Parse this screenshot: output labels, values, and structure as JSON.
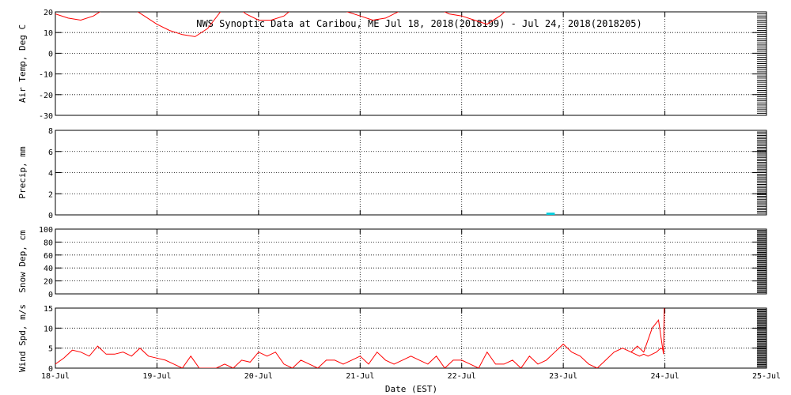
{
  "chart_data": {
    "type": "line",
    "title": "NWS Synoptic Data at Caribou, ME   Jul 18, 2018(2018199) - Jul 24, 2018(2018205)",
    "xlabel": "Date (EST)",
    "x_tick_labels": [
      "18-Jul",
      "19-Jul",
      "20-Jul",
      "21-Jul",
      "22-Jul",
      "23-Jul",
      "24-Jul",
      "25-Jul"
    ],
    "xlim": [
      "2018-07-18",
      "2018-07-25"
    ],
    "grid": true,
    "panels": [
      {
        "ylabel": "Air Temp, Deg C",
        "ylim": [
          -30,
          20
        ],
        "yticks": [
          -30,
          -20,
          -10,
          0,
          10,
          20
        ],
        "series": [
          {
            "color": "#ff0000",
            "x": [
              "2018-07-18T00:00",
              "2018-07-18T03:00",
              "2018-07-18T06:00",
              "2018-07-18T09:00",
              "2018-07-18T12:00",
              "2018-07-18T15:00",
              "2018-07-18T18:00",
              "2018-07-18T21:00",
              "2018-07-19T00:00",
              "2018-07-19T03:00",
              "2018-07-19T06:00",
              "2018-07-19T09:00",
              "2018-07-19T12:00",
              "2018-07-19T15:00",
              "2018-07-19T18:00",
              "2018-07-19T21:00",
              "2018-07-20T00:00",
              "2018-07-20T03:00",
              "2018-07-20T06:00",
              "2018-07-20T09:00",
              "2018-07-20T12:00",
              "2018-07-20T15:00",
              "2018-07-20T18:00",
              "2018-07-20T21:00",
              "2018-07-21T00:00",
              "2018-07-21T03:00",
              "2018-07-21T06:00",
              "2018-07-21T09:00",
              "2018-07-21T12:00",
              "2018-07-21T15:00",
              "2018-07-21T18:00",
              "2018-07-21T21:00",
              "2018-07-22T00:00",
              "2018-07-22T03:00",
              "2018-07-22T06:00",
              "2018-07-22T09:00",
              "2018-07-22T12:00"
            ],
            "y": [
              19,
              17,
              16,
              18,
              22,
              24,
              22,
              18,
              14,
              11,
              9,
              8,
              12,
              20,
              24,
              19,
              16,
              16,
              18,
              23,
              25,
              24,
              22,
              20,
              18,
              16,
              17,
              20,
              24,
              25,
              22,
              19,
              18,
              16,
              14,
              18,
              23
            ]
          }
        ]
      },
      {
        "ylabel": "Precip, mm",
        "ylim": [
          0,
          8
        ],
        "yticks": [
          0,
          2,
          4,
          6,
          8
        ],
        "series": [
          {
            "color": "#00ccdd",
            "x": [
              "2018-07-22T20:00",
              "2018-07-22T21:00",
              "2018-07-22T22:00"
            ],
            "y": [
              0.1,
              0.1,
              0.1
            ]
          }
        ]
      },
      {
        "ylabel": "Snow Dep, cm",
        "ylim": [
          0,
          100
        ],
        "yticks": [
          0,
          20,
          40,
          60,
          80,
          100
        ],
        "series": []
      },
      {
        "ylabel": "Wind Spd, m/s",
        "ylim": [
          0,
          15
        ],
        "yticks": [
          0,
          5,
          10,
          15
        ],
        "series": [
          {
            "color": "#ff0000",
            "x": [
              "2018-07-18T00:00",
              "2018-07-18T02:00",
              "2018-07-18T04:00",
              "2018-07-18T06:00",
              "2018-07-18T08:00",
              "2018-07-18T10:00",
              "2018-07-18T12:00",
              "2018-07-18T14:00",
              "2018-07-18T16:00",
              "2018-07-18T18:00",
              "2018-07-18T20:00",
              "2018-07-18T22:00",
              "2018-07-19T00:00",
              "2018-07-19T02:00",
              "2018-07-19T04:00",
              "2018-07-19T06:00",
              "2018-07-19T08:00",
              "2018-07-19T10:00",
              "2018-07-19T12:00",
              "2018-07-19T14:00",
              "2018-07-19T16:00",
              "2018-07-19T18:00",
              "2018-07-19T20:00",
              "2018-07-19T22:00",
              "2018-07-20T00:00",
              "2018-07-20T02:00",
              "2018-07-20T04:00",
              "2018-07-20T06:00",
              "2018-07-20T08:00",
              "2018-07-20T10:00",
              "2018-07-20T12:00",
              "2018-07-20T14:00",
              "2018-07-20T16:00",
              "2018-07-20T18:00",
              "2018-07-20T20:00",
              "2018-07-20T22:00",
              "2018-07-21T00:00",
              "2018-07-21T02:00",
              "2018-07-21T04:00",
              "2018-07-21T06:00",
              "2018-07-21T08:00",
              "2018-07-21T10:00",
              "2018-07-21T12:00",
              "2018-07-21T14:00",
              "2018-07-21T16:00",
              "2018-07-21T18:00",
              "2018-07-21T20:00",
              "2018-07-21T22:00",
              "2018-07-22T00:00",
              "2018-07-22T02:00",
              "2018-07-22T04:00",
              "2018-07-22T06:00",
              "2018-07-22T08:00",
              "2018-07-22T10:00",
              "2018-07-22T12:00",
              "2018-07-22T14:00",
              "2018-07-22T16:00",
              "2018-07-22T18:00",
              "2018-07-22T20:00",
              "2018-07-22T22:00",
              "2018-07-23T00:00",
              "2018-07-23T02:00",
              "2018-07-23T04:00",
              "2018-07-23T06:00",
              "2018-07-23T08:00",
              "2018-07-23T10:00",
              "2018-07-23T12:00",
              "2018-07-23T14:00",
              "2018-07-23T16:00",
              "2018-07-23T18:00",
              "2018-07-23T19:00",
              "2018-07-23T20:00",
              "2018-07-23T21:00",
              "2018-07-23T22:00",
              "2018-07-23T23:00",
              "2018-07-23T23:50"
            ],
            "y": [
              1,
              2.5,
              4.5,
              4,
              3,
              5.5,
              3.5,
              3.5,
              4,
              3,
              5,
              3,
              2.5,
              2,
              1,
              0,
              3,
              0,
              0,
              0,
              1,
              0,
              2,
              1.5,
              4,
              3,
              4,
              1,
              0,
              2,
              1,
              0,
              2,
              2,
              1,
              2,
              3,
              1,
              4,
              2,
              1,
              2,
              3,
              2,
              1,
              3,
              0,
              2,
              2,
              1,
              0,
              4,
              1,
              1,
              2,
              0,
              3,
              1,
              2,
              4,
              6,
              4,
              3,
              1,
              0,
              2,
              4,
              5,
              4,
              3,
              3.5,
              3,
              3.5,
              4,
              5,
              4.5
            ],
            "tail_x": [
              "2018-07-23T16:00",
              "2018-07-23T17:30",
              "2018-07-23T19:00",
              "2018-07-23T21:00",
              "2018-07-23T22:30",
              "2018-07-23T23:40",
              "2018-07-23T23:50"
            ],
            "tail_y": [
              4,
              5.5,
              4,
              10,
              12,
              3.5,
              15
            ]
          }
        ]
      }
    ]
  }
}
